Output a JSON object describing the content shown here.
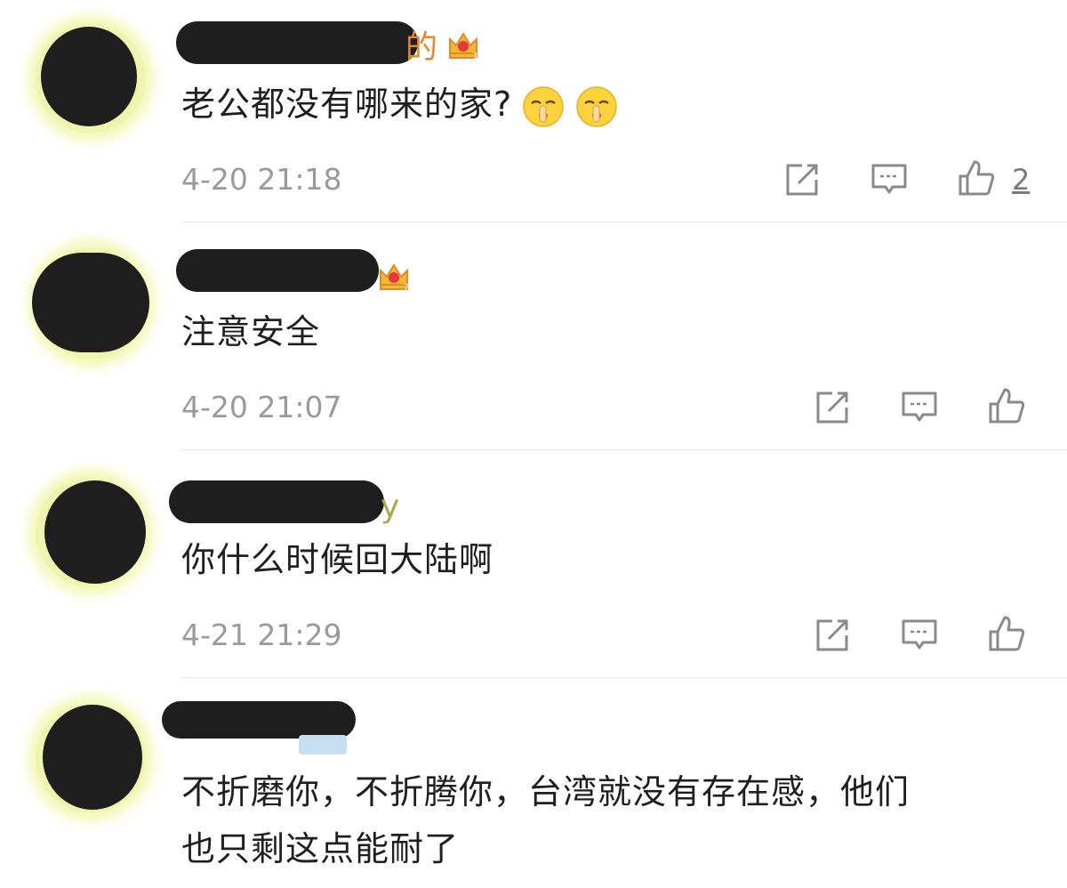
{
  "colors": {
    "timestamp": "#9a9a9a",
    "username_gold": "#e28a2b",
    "username_olive": "#a6ab4f",
    "icon_gray": "#8a8a8a",
    "avatar_glow": "#eef5a0",
    "divider": "#e6e6e6"
  },
  "icons": {
    "vip_crown": "crown-icon",
    "share": "share-icon",
    "reply": "comment-icon",
    "like": "thumbs-up-icon",
    "emoji": "shush-face-emoji"
  },
  "comments": [
    {
      "name_tail": "的",
      "vip_level": "1",
      "body": "老公都没有哪来的家?",
      "emoji_count": 2,
      "time": "4-20 21:18",
      "likes": "2"
    },
    {
      "name_tail": "",
      "vip_level": "7",
      "body": "注意安全",
      "time": "4-20 21:07",
      "likes": ""
    },
    {
      "name_tail": "y",
      "body": "你什么时候回大陆啊",
      "time": "4-21 21:29",
      "likes": ""
    },
    {
      "name_tail": "",
      "body_lines": [
        "不折磨你，不折腾你，台湾就没有存在感，他们",
        "也只剩这点能耐了"
      ]
    }
  ]
}
